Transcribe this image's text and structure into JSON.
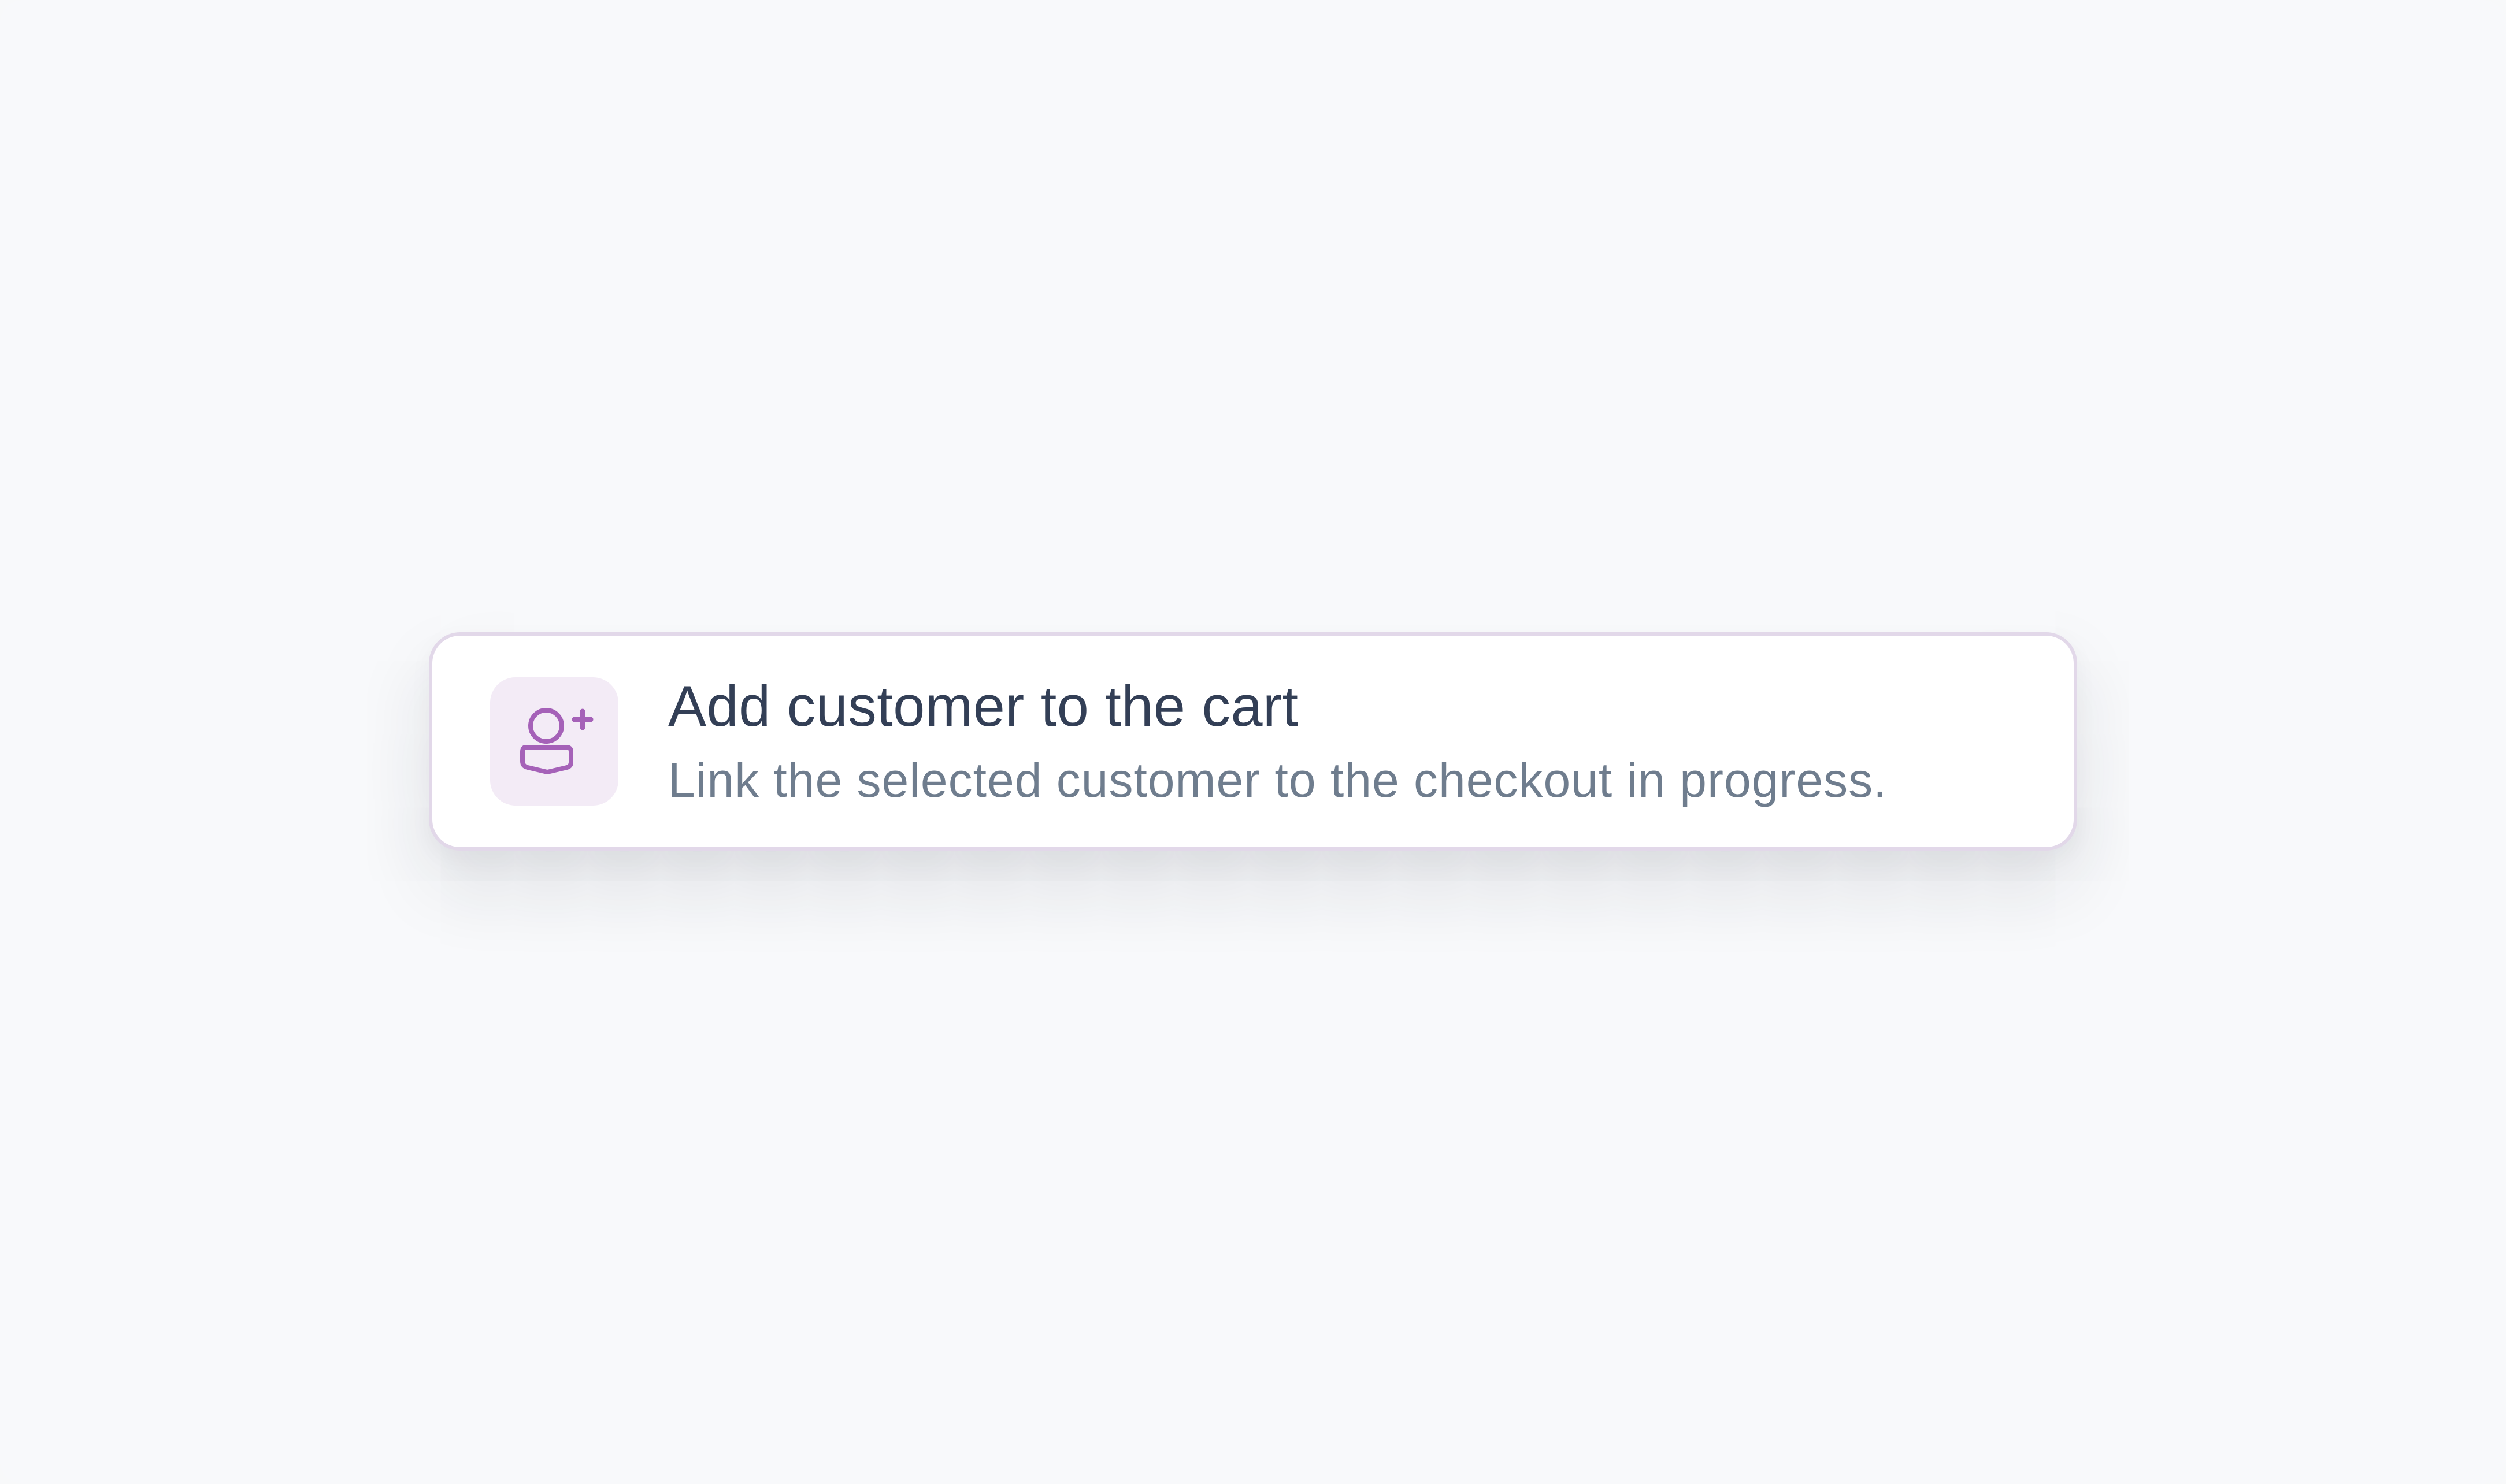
{
  "action_card": {
    "icon": "user-plus-icon",
    "accent_color": "#a561b8",
    "icon_tile_color": "#f3ebf6",
    "border_color": "#e2d8e9",
    "title": "Add customer to the cart",
    "description": "Link the selected customer to the checkout in progress."
  }
}
